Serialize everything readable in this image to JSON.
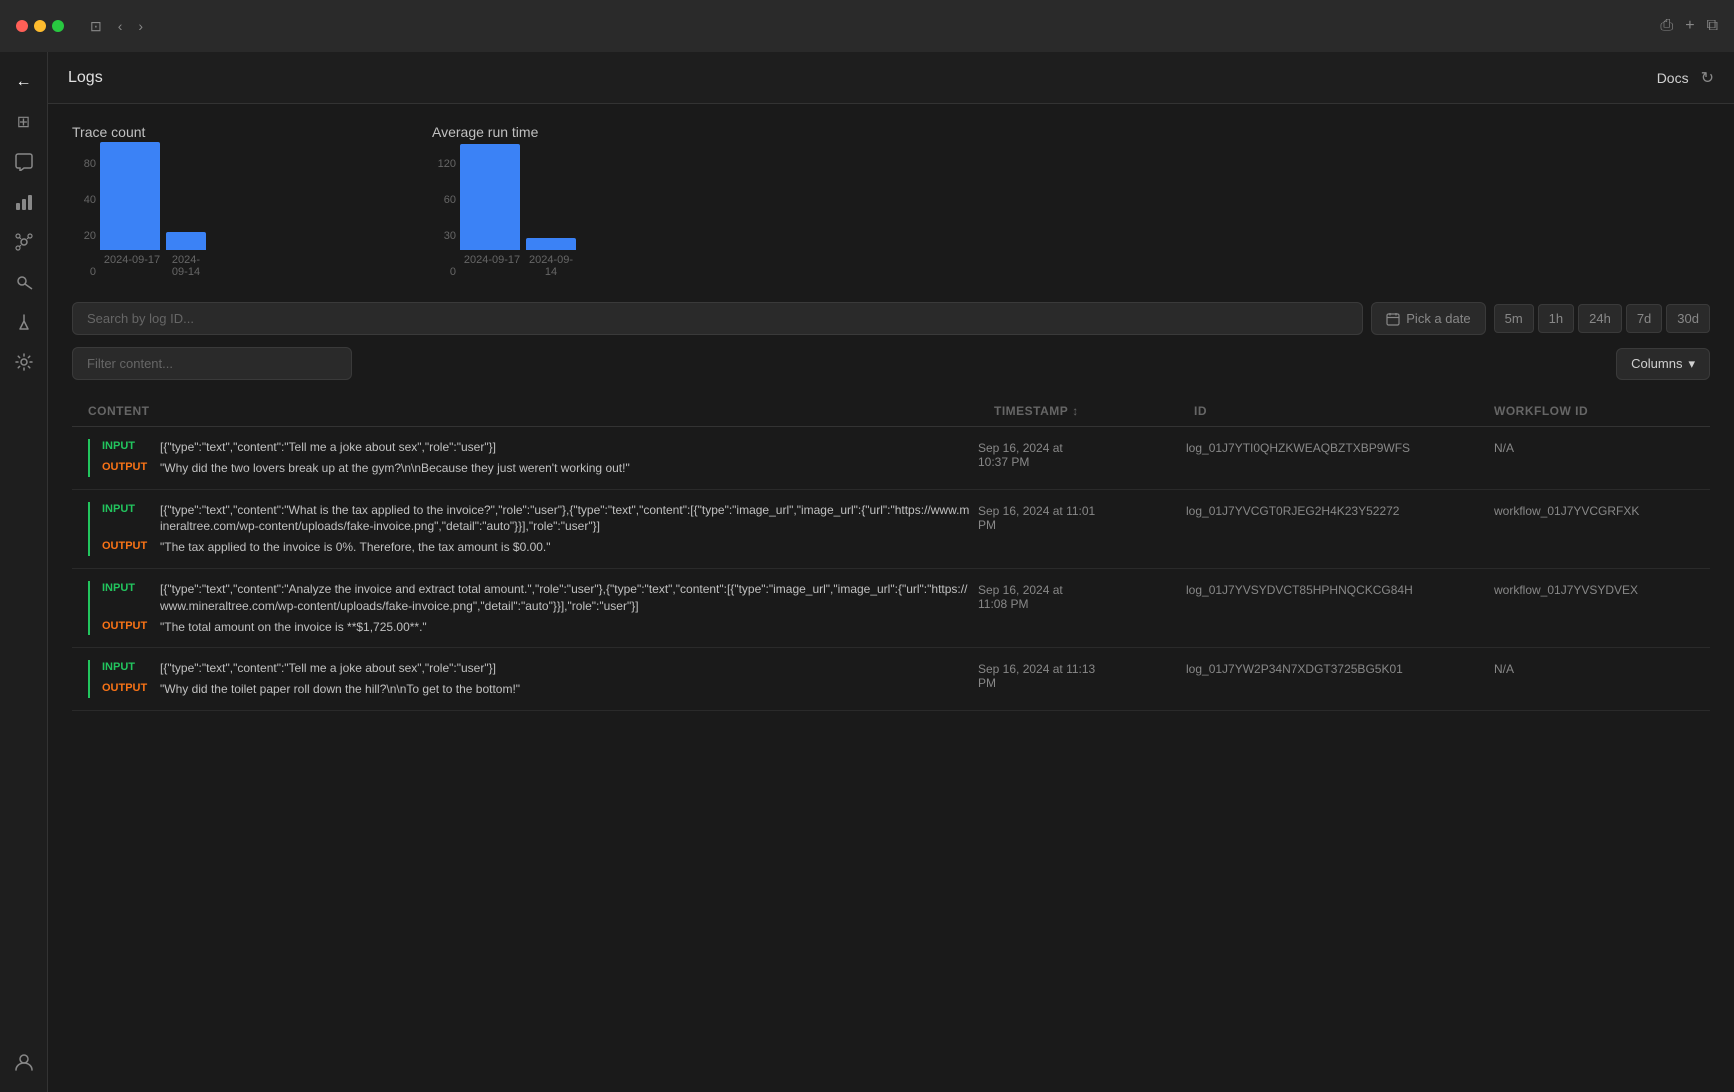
{
  "titlebar": {
    "nav_back": "‹",
    "nav_forward": "›"
  },
  "topbar": {
    "title": "Logs",
    "docs_label": "Docs",
    "refresh_icon": "↻"
  },
  "sidebar": {
    "icons": [
      {
        "name": "back-icon",
        "symbol": "←"
      },
      {
        "name": "dashboard-icon",
        "symbol": "⊞"
      },
      {
        "name": "chat-icon",
        "symbol": "💬"
      },
      {
        "name": "chart-icon",
        "symbol": "📊"
      },
      {
        "name": "graph-icon",
        "symbol": "⚭"
      },
      {
        "name": "key-icon",
        "symbol": "🔑"
      },
      {
        "name": "webhook-icon",
        "symbol": "⚡"
      },
      {
        "name": "settings-icon",
        "symbol": "⚙"
      }
    ],
    "bottom_icon": {
      "name": "user-icon",
      "symbol": "👤"
    }
  },
  "charts": {
    "trace_count": {
      "title": "Trace count",
      "y_labels": [
        "80",
        "40",
        "20",
        "0"
      ],
      "bars": [
        {
          "label": "2024-09-17",
          "height_pct": 90
        },
        {
          "label": "2024-09-14",
          "height_pct": 15
        }
      ]
    },
    "avg_run_time": {
      "title": "Average run time",
      "y_labels": [
        "120",
        "60",
        "30",
        "0"
      ],
      "bars": [
        {
          "label": "2024-09-17",
          "height_pct": 88
        },
        {
          "label": "2024-09-14",
          "height_pct": 10
        }
      ]
    }
  },
  "search": {
    "placeholder": "Search by log ID...",
    "date_placeholder": "Pick a date",
    "time_buttons": [
      "5m",
      "1h",
      "24h",
      "7d",
      "30d"
    ]
  },
  "filter": {
    "placeholder": "Filter content...",
    "columns_label": "Columns",
    "columns_icon": "▾"
  },
  "table": {
    "headers": {
      "content": "CONTENT",
      "timestamp": "TIMESTAMP",
      "id": "ID",
      "workflow_id": "WORKFLOW ID"
    },
    "rows": [
      {
        "input": "[{\"type\":\"text\",\"content\":\"Tell me a joke about sex\",\"role\":\"user\"}]",
        "output": "\"Why did the two lovers break up at the gym?\\n\\nBecause they just weren't working out!\"",
        "timestamp": "Sep 16, 2024 at\n10:37 PM",
        "id": "log_01J7YTI0QHZKWEAQBZTXBP9WFS",
        "workflow_id": "N/A"
      },
      {
        "input": "[{\"type\":\"text\",\"content\":\"What is the tax applied to the invoice?\",\"role\":\"user\"},{\"type\":\"text\",\"content\":[{\"type\":\"image_url\",\"image_url\":{\"url\":\"https://www.mineraltree.com/wp-content/uploads/fake-invoice.png\",\"detail\":\"auto\"}}],\"role\":\"user\"}]",
        "output": "\"The tax applied to the invoice is 0%. Therefore, the tax amount is $0.00.\"",
        "timestamp": "Sep 16, 2024 at 11:01\nPM",
        "id": "log_01J7YVCGT0RJEG2H4K23Y52272",
        "workflow_id": "workflow_01J7YVCGRFXK"
      },
      {
        "input": "[{\"type\":\"text\",\"content\":\"Analyze the invoice and extract total amount.\",\"role\":\"user\"},{\"type\":\"text\",\"content\":[{\"type\":\"image_url\",\"image_url\":{\"url\":\"https://www.mineraltree.com/wp-content/uploads/fake-invoice.png\",\"detail\":\"auto\"}}],\"role\":\"user\"}]",
        "output": "\"The total amount on the invoice is **$1,725.00**.\"",
        "timestamp": "Sep 16, 2024 at\n11:08 PM",
        "id": "log_01J7YVSYDVCT85HPHNQCKCG84H",
        "workflow_id": "workflow_01J7YVSYDVEX"
      },
      {
        "input": "[{\"type\":\"text\",\"content\":\"Tell me a joke about sex\",\"role\":\"user\"}]",
        "output": "\"Why did the toilet paper roll down the hill?\\n\\nTo get to the bottom!\"",
        "timestamp": "Sep 16, 2024 at 11:13\nPM",
        "id": "log_01J7YW2P34N7XDGT3725BG5K01",
        "workflow_id": "N/A"
      }
    ]
  },
  "colors": {
    "input_badge": "#22c55e",
    "output_badge": "#f97316",
    "bar_color": "#3b82f6",
    "accent": "#3b82f6"
  }
}
